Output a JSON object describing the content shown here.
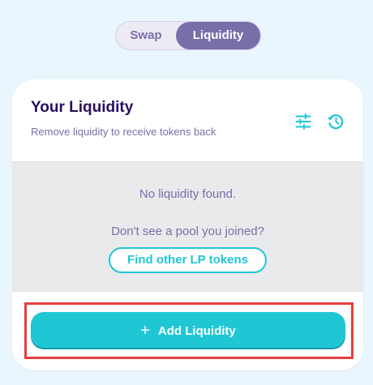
{
  "tabs": {
    "swap_label": "Swap",
    "liquidity_label": "Liquidity",
    "active": "Liquidity"
  },
  "card": {
    "title": "Your Liquidity",
    "subtitle": "Remove liquidity to receive tokens back",
    "icons": {
      "settings": "settings-sliders-icon",
      "history": "history-clock-icon"
    }
  },
  "body": {
    "empty_message": "No liquidity found.",
    "pool_prompt": "Don't see a pool you joined?",
    "find_lp_label": "Find other LP tokens"
  },
  "footer": {
    "add_liquidity_icon": "+",
    "add_liquidity_label": "Add Liquidity"
  },
  "colors": {
    "accent": "#1fc7d4",
    "primary_text": "#280d5f",
    "secondary_text": "#7a6eaa",
    "highlight": "#e53e3e"
  }
}
